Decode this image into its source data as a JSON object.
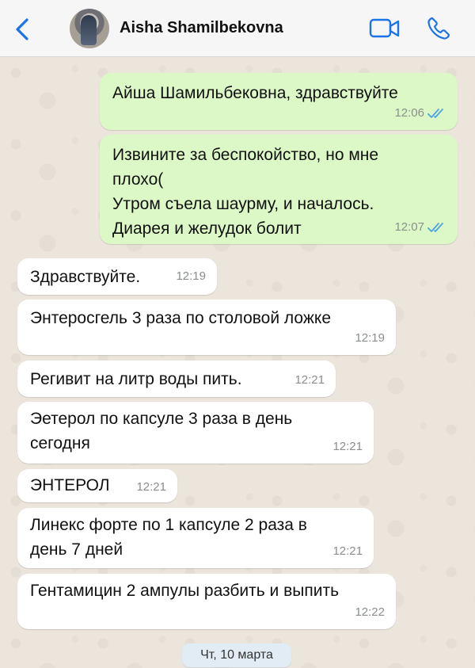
{
  "header": {
    "contact_name": "Aisha Shamilbekovna",
    "icons": [
      "chevron-left-icon",
      "video-call-icon",
      "phone-icon"
    ],
    "accent_color": "#1a73e8"
  },
  "messages": [
    {
      "direction": "outgoing",
      "text": "Айша Шамильбековна, здравствуйте",
      "time": "12:06",
      "status": "read"
    },
    {
      "direction": "outgoing",
      "text": "Извините за беспокойство, но мне\nплохо(\nУтром съела шаурму, и началось.\nДиарея и желудок болит",
      "time": "12:07",
      "status": "read"
    },
    {
      "direction": "incoming",
      "text": "Здравствуйте.",
      "time": "12:19"
    },
    {
      "direction": "incoming",
      "text": "Энтеросгель 3 раза по столовой ложке",
      "time": "12:19"
    },
    {
      "direction": "incoming",
      "text": "Регивит на литр воды пить.",
      "time": "12:21"
    },
    {
      "direction": "incoming",
      "text": "Эетерол по капсуле 3 раза в день\nсегодня",
      "time": "12:21"
    },
    {
      "direction": "incoming",
      "text": "ЭНТЕРОЛ",
      "time": "12:21"
    },
    {
      "direction": "incoming",
      "text": "Линекс форте по 1 капсуле 2 раза в\nдень 7 дней",
      "time": "12:21"
    },
    {
      "direction": "incoming",
      "text": "Гентамицин 2 ампулы разбить и выпить",
      "time": "12:22"
    }
  ],
  "date_separator": "Чт, 10 марта",
  "colors": {
    "outgoing_bubble": "#dcf8c6",
    "incoming_bubble": "#ffffff",
    "read_check": "#4fa3e0"
  }
}
